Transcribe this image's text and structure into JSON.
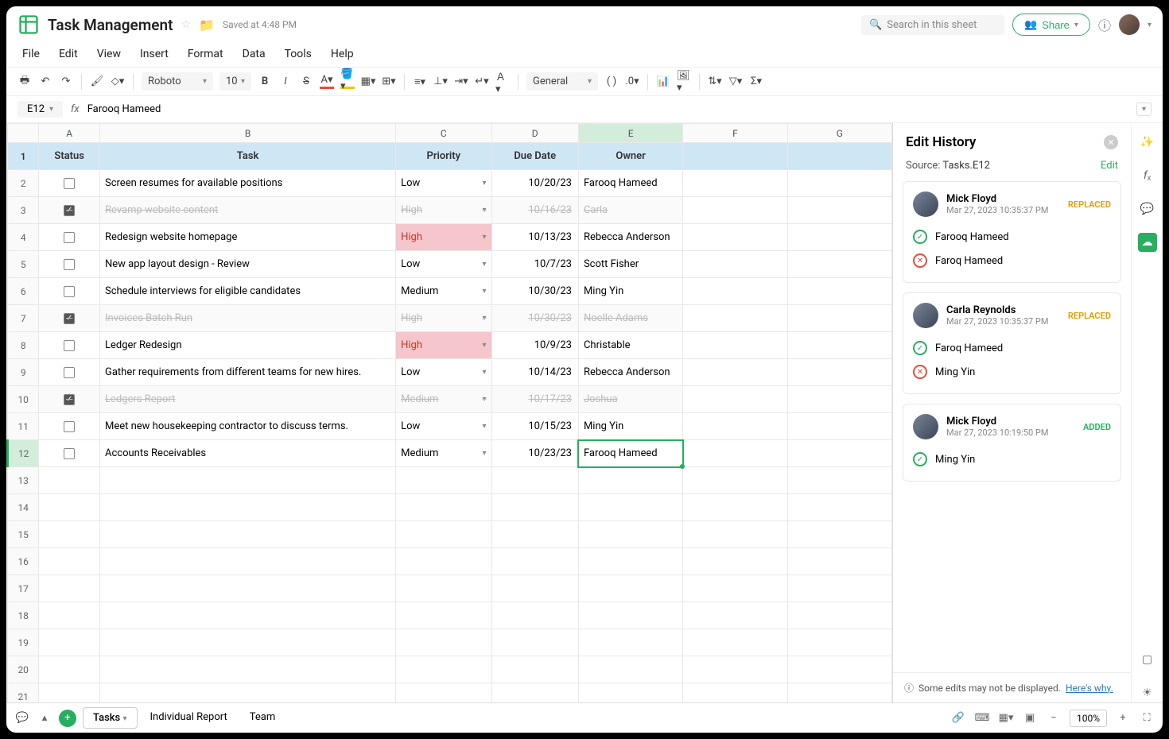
{
  "header": {
    "title": "Task Management",
    "saved": "Saved at 4:48 PM",
    "search_placeholder": "Search in this sheet",
    "share": "Share"
  },
  "menubar": [
    "File",
    "Edit",
    "View",
    "Insert",
    "Format",
    "Data",
    "Tools",
    "Help"
  ],
  "toolbar": {
    "font": "Roboto",
    "size": "10",
    "format": "General"
  },
  "formula": {
    "cell": "E12",
    "value": "Farooq Hameed"
  },
  "columns": [
    "A",
    "B",
    "C",
    "D",
    "E",
    "F",
    "G"
  ],
  "headers": {
    "status": "Status",
    "task": "Task",
    "priority": "Priority",
    "due": "Due Date",
    "owner": "Owner"
  },
  "rows": [
    {
      "n": 1
    },
    {
      "n": 2,
      "done": false,
      "task": "Screen resumes for available positions",
      "priority": "Low",
      "due": "10/20/23",
      "owner": "Farooq Hameed"
    },
    {
      "n": 3,
      "done": true,
      "task": "Revamp website content",
      "priority": "High",
      "due": "10/16/23",
      "owner": "Carla"
    },
    {
      "n": 4,
      "done": false,
      "task": "Redesign website homepage",
      "priority": "High",
      "pred": true,
      "due": "10/13/23",
      "owner": "Rebecca Anderson"
    },
    {
      "n": 5,
      "done": false,
      "task": "New app layout design - Review",
      "priority": "Low",
      "due": "10/7/23",
      "owner": "Scott Fisher"
    },
    {
      "n": 6,
      "done": false,
      "task": "Schedule interviews for eligible candidates",
      "priority": "Medium",
      "due": "10/30/23",
      "owner": "Ming Yin"
    },
    {
      "n": 7,
      "done": true,
      "task": "Invoices Batch Run",
      "priority": "High",
      "due": "10/30/23",
      "owner": "Noelle Adams"
    },
    {
      "n": 8,
      "done": false,
      "task": "Ledger Redesign",
      "priority": "High",
      "pred": true,
      "due": "10/9/23",
      "owner": "Christable"
    },
    {
      "n": 9,
      "done": false,
      "task": "Gather requirements from different teams for new hires.",
      "priority": "Low",
      "due": "10/14/23",
      "owner": "Rebecca Anderson"
    },
    {
      "n": 10,
      "done": true,
      "task": "Ledgers Report",
      "priority": "Medium",
      "due": "10/17/23",
      "owner": "Joshua"
    },
    {
      "n": 11,
      "done": false,
      "task": "Meet new housekeeping contractor to discuss terms.",
      "priority": "Low",
      "due": "10/15/23",
      "owner": "Ming Yin"
    },
    {
      "n": 12,
      "done": false,
      "task": "Accounts Receivables",
      "priority": "Medium",
      "due": "10/23/23",
      "owner": "Farooq Hameed",
      "selected": true
    },
    {
      "n": 13
    },
    {
      "n": 14
    },
    {
      "n": 15
    },
    {
      "n": 16
    },
    {
      "n": 17
    },
    {
      "n": 18
    },
    {
      "n": 19
    },
    {
      "n": 20
    },
    {
      "n": 21
    }
  ],
  "history": {
    "title": "Edit History",
    "source_label": "Source:",
    "source": "Tasks.E12",
    "edit": "Edit",
    "cards": [
      {
        "name": "Mick Floyd",
        "time": "Mar 27, 2023 10:35:37 PM",
        "badge": "REPLACED",
        "badgeClass": "replaced",
        "lines": [
          {
            "ok": true,
            "text": "Farooq Hameed"
          },
          {
            "ok": false,
            "text": "Faroq Hameed"
          }
        ]
      },
      {
        "name": "Carla Reynolds",
        "time": "Mar 27, 2023 10:35:37 PM",
        "badge": "REPLACED",
        "badgeClass": "replaced",
        "lines": [
          {
            "ok": true,
            "text": "Faroq Hameed"
          },
          {
            "ok": false,
            "text": "Ming Yin"
          }
        ]
      },
      {
        "name": "Mick Floyd",
        "time": "Mar 27, 2023 10:19:50 PM",
        "badge": "ADDED",
        "badgeClass": "added",
        "lines": [
          {
            "ok": true,
            "text": "Ming Yin"
          }
        ]
      }
    ],
    "footer": "Some edits may not be displayed.",
    "footer_link": "Here's why."
  },
  "tabs": [
    "Tasks",
    "Individual Report",
    "Team"
  ],
  "zoom": "100%"
}
